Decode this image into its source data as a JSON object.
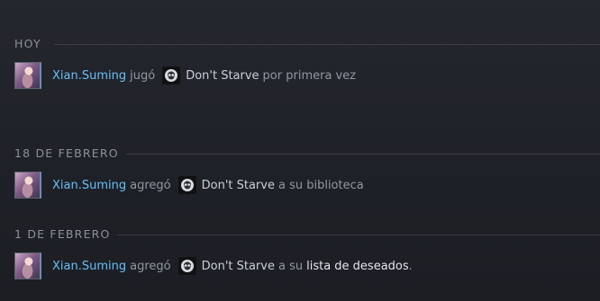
{
  "sections": [
    {
      "date": "HOY",
      "event": {
        "user": "Xian.Suming",
        "verb": "jugó",
        "game": "Don't Starve",
        "suffix": "por primera vez"
      }
    },
    {
      "date": "18 DE FEBRERO",
      "event": {
        "user": "Xian.Suming",
        "verb": "agregó",
        "game": "Don't Starve",
        "suffix": "a su biblioteca"
      }
    },
    {
      "date": "1 DE FEBRERO",
      "event": {
        "user": "Xian.Suming",
        "verb": "agregó",
        "game": "Don't Starve",
        "suffix": "a su",
        "link": "lista de deseados",
        "end": "."
      }
    }
  ],
  "icons": {
    "avatar": "user-avatar",
    "game": "dont-starve-icon"
  },
  "colors": {
    "username": "#66c0f4",
    "verb": "#8f98a0",
    "date": "#8b929b",
    "background": "#1f2128"
  }
}
